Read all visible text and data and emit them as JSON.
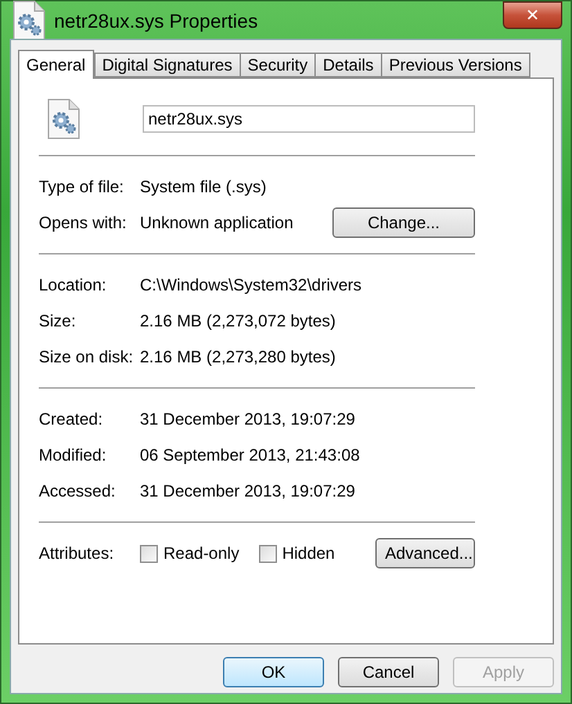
{
  "window": {
    "title": "netr28ux.sys Properties",
    "close": "✕"
  },
  "tabs": [
    {
      "label": "General",
      "selected": true
    },
    {
      "label": "Digital Signatures",
      "selected": false
    },
    {
      "label": "Security",
      "selected": false
    },
    {
      "label": "Details",
      "selected": false
    },
    {
      "label": "Previous Versions",
      "selected": false
    }
  ],
  "file_name": "netr28ux.sys",
  "sections": [
    [
      {
        "label": "Type of file:",
        "value": "System file (.sys)"
      },
      {
        "label": "Opens with:",
        "value": "Unknown application",
        "button": "Change..."
      }
    ],
    [
      {
        "label": "Location:",
        "value": "C:\\Windows\\System32\\drivers"
      },
      {
        "label": "Size:",
        "value": "2.16 MB (2,273,072 bytes)"
      },
      {
        "label": "Size on disk:",
        "value": "2.16 MB (2,273,280 bytes)"
      }
    ],
    [
      {
        "label": "Created:",
        "value": "31 December 2013, 19:07:29"
      },
      {
        "label": "Modified:",
        "value": "06 September 2013, 21:43:08"
      },
      {
        "label": "Accessed:",
        "value": "31 December 2013, 19:07:29"
      }
    ]
  ],
  "attributes": {
    "label": "Attributes:",
    "options": [
      {
        "label": "Read-only",
        "checked": false
      },
      {
        "label": "Hidden",
        "checked": false
      }
    ],
    "button": "Advanced..."
  },
  "buttons": [
    {
      "label": "OK",
      "default": true,
      "disabled": false
    },
    {
      "label": "Cancel",
      "default": false,
      "disabled": false
    },
    {
      "label": "Apply",
      "default": false,
      "disabled": true
    }
  ]
}
